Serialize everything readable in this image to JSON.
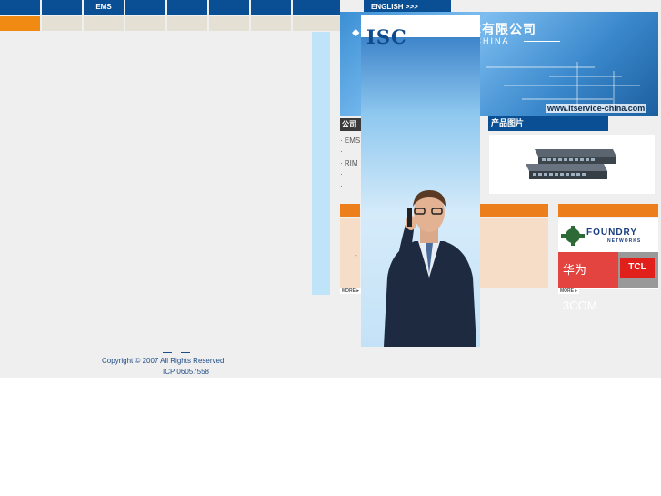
{
  "nav": {
    "items": [
      {
        "label": ""
      },
      {
        "label": ""
      },
      {
        "label": "EMS"
      },
      {
        "label": ""
      },
      {
        "label": ""
      },
      {
        "label": ""
      },
      {
        "label": ""
      },
      {
        "label": ""
      }
    ],
    "english_label": "ENGLISH >>>"
  },
  "banner": {
    "title": "技术有限公司",
    "subtitle": "E CHINA",
    "url": "www.itservice-china.com",
    "logo": "ISC"
  },
  "sections": {
    "company_title": "公司",
    "company_list": [
      "· EMS",
      "·",
      "·  RIM",
      "·",
      "·"
    ],
    "products_title": "产品图片",
    "news_dash": "-",
    "more_label": "MORE ▸",
    "partner_foundry": "FOUNDRY",
    "partner_foundry_sub": "NETWORKS",
    "partner_huawei_3com": "华为 3COM",
    "partner_tcl": "TCL"
  },
  "footer": {
    "copyright": "Copyright © 2007          All Rights Reserved",
    "icp": "ICP 06057558"
  },
  "colors": {
    "nav_blue": "#0a4f94",
    "accent_orange": "#ec7f1b",
    "peach": "#f6ddc7",
    "footer_text": "#1f4d88"
  }
}
